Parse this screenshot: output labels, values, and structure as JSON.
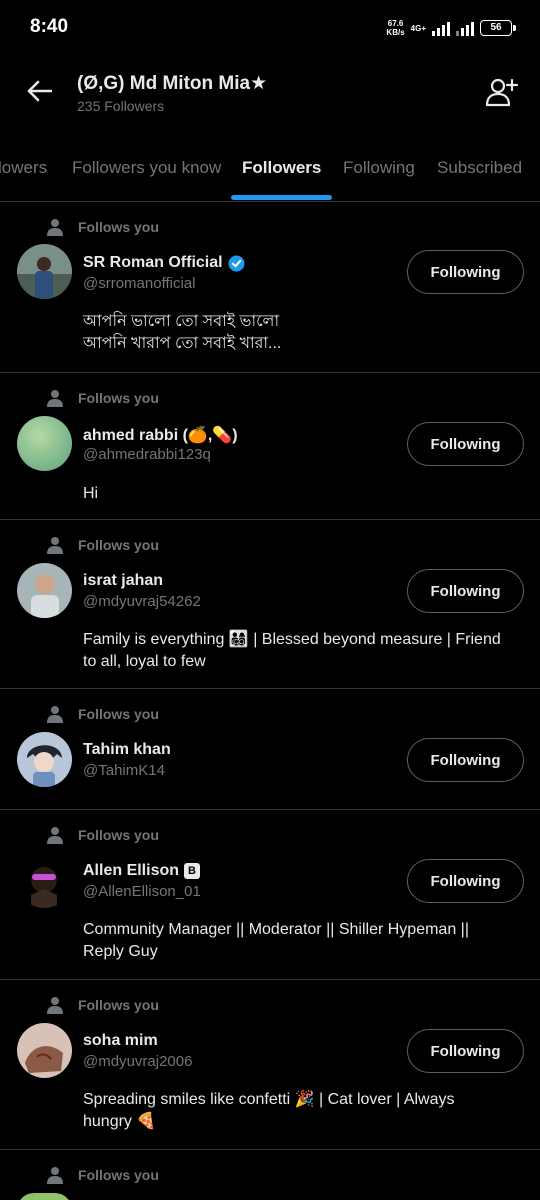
{
  "status_bar": {
    "time": "8:40",
    "net_speed": "67.6",
    "net_speed_unit": "KB/s",
    "net_type": "4G+",
    "battery": "56"
  },
  "header": {
    "title": "(Ø,G) Md Miton Mia★",
    "subtitle": "235 Followers",
    "back_icon": "arrow-left-icon",
    "add_user_icon": "person-add-icon"
  },
  "tabs": [
    {
      "label": "lowers"
    },
    {
      "label": "Followers you know"
    },
    {
      "label": "Followers",
      "active": true
    },
    {
      "label": "Following"
    },
    {
      "label": "Subscribed"
    }
  ],
  "accent_color": "#1d9bf0",
  "follows_you_label": "Follows you",
  "followers": [
    {
      "name": "SR Roman Official",
      "verified": true,
      "handle": "@srromanofficial",
      "bio_line1": "আপনি ভালো তো সবাই ভালো",
      "bio_line2": "আপনি খারাপ তো সবাই খারা...",
      "button": "Following"
    },
    {
      "name": "ahmed rabbi (🍊,💊)",
      "handle": "@ahmedrabbi123q",
      "bio_line1": "Hi",
      "button": "Following"
    },
    {
      "name": "israt jahan",
      "handle": "@mdyuvraj54262",
      "bio_line1": "Family is everything 👨‍👩‍👧‍👦 | Blessed beyond measure | Friend",
      "bio_line2": "to all, loyal to few",
      "button": "Following"
    },
    {
      "name": "Tahim khan",
      "handle": "@TahimK14",
      "button": "Following"
    },
    {
      "name": "Allen Ellison",
      "badge": "B",
      "handle": "@AllenEllison_01",
      "bio_line1": "Community Manager || Moderator || Shiller  Hypeman ||",
      "bio_line2": "Reply Guy",
      "button": "Following"
    },
    {
      "name": "soha mim",
      "handle": "@mdyuvraj2006",
      "bio_line1": "Spreading smiles like confetti 🎉 | Cat lover | Always",
      "bio_line2": "hungry 🍕",
      "button": "Following"
    },
    {
      "name": "",
      "handle": ""
    }
  ]
}
